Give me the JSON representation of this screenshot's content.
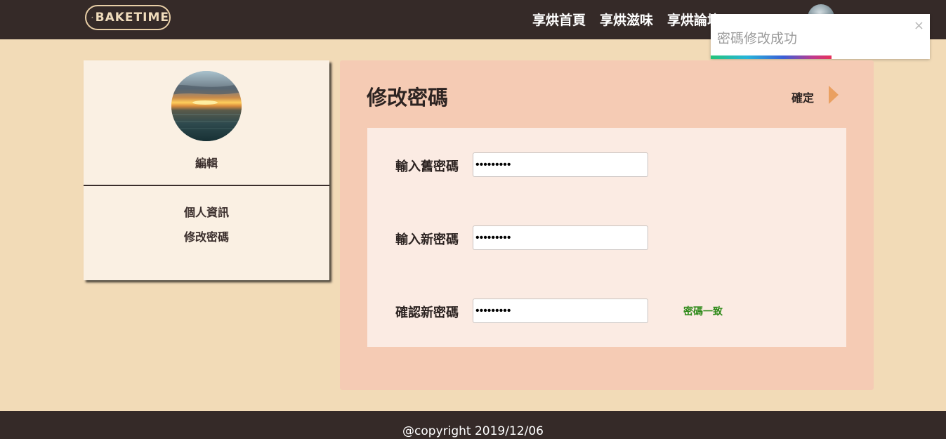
{
  "navbar": {
    "logo_text": "BAKETIME",
    "links": [
      "享烘首頁",
      "享烘滋味",
      "享烘論壇"
    ]
  },
  "toast": {
    "message": "密碼修改成功",
    "close": "×",
    "progress": 0.55
  },
  "sidebar": {
    "edit_label": "編輯",
    "items": [
      "個人資訊",
      "修改密碼"
    ]
  },
  "main": {
    "title": "修改密碼",
    "confirm_label": "確定",
    "fields": [
      {
        "label": "輸入舊密碼",
        "value": "•••••••••"
      },
      {
        "label": "輸入新密碼",
        "value": "•••••••••"
      },
      {
        "label": "確認新密碼",
        "value": "•••••••••"
      }
    ],
    "match_message": "密碼一致"
  },
  "footer": {
    "text": "@copyright 2019/12/06"
  },
  "colors": {
    "navbar": "#352a28",
    "page_bg": "#f2dbb7",
    "main_panel": "#f5cbb4",
    "accent_arrow": "#eaa061",
    "match_green": "#2f8a1a"
  }
}
